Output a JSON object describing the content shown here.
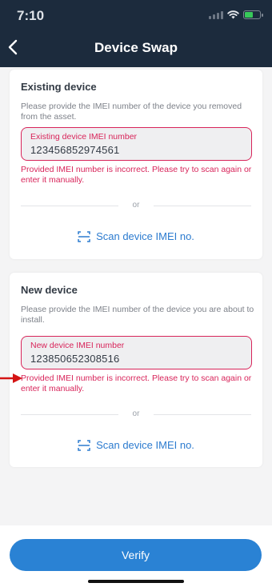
{
  "status_bar": {
    "time": "7:10"
  },
  "header": {
    "title": "Device Swap",
    "back_icon": "chevron-left-icon"
  },
  "existing": {
    "title": "Existing device",
    "description": "Please provide the IMEI number of the device you removed from the asset.",
    "field_label": "Existing device IMEI number",
    "field_value": "123456852974561",
    "error": "Provided IMEI number is incorrect. Please try to scan again or enter it manually.",
    "divider_text": "or",
    "scan_label": "Scan device IMEI no.",
    "scan_icon": "scan-icon"
  },
  "new": {
    "title": "New device",
    "description": "Please provide the IMEI number of the device you are about to install.",
    "field_label": "New device IMEI number",
    "field_value": "123850652308516",
    "error": "Provided IMEI number is incorrect. Please try to scan again or enter it manually.",
    "divider_text": "or",
    "scan_label": "Scan device IMEI no.",
    "scan_icon": "scan-icon"
  },
  "footer": {
    "verify_label": "Verify"
  },
  "colors": {
    "header": "#1c2b3d",
    "accent": "#2a82d4",
    "error": "#d8245a"
  }
}
